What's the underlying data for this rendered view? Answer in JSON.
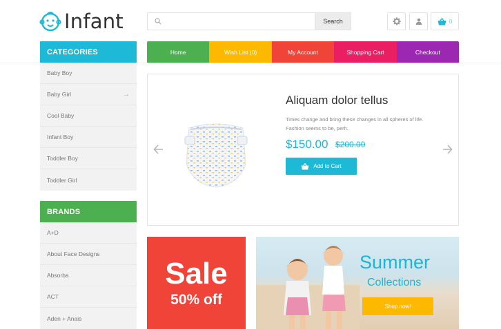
{
  "header": {
    "logo_text": "Infant",
    "search": {
      "placeholder": "",
      "button_label": "Search"
    },
    "cart_count": "0"
  },
  "nav": [
    {
      "label": "Home",
      "color": "#4caf50"
    },
    {
      "label": "Wish List (0)",
      "color": "#fcb900"
    },
    {
      "label": "My Account",
      "color": "#f04438"
    },
    {
      "label": "Shopping Cart",
      "color": "#e91e63"
    },
    {
      "label": "Checkout",
      "color": "#9c27b0"
    }
  ],
  "categories": {
    "title": "CATEGORIES",
    "color": "#1eb9d6",
    "items": [
      "Baby Boy",
      "Baby Girl",
      "Cool Baby",
      "Infant Boy",
      "Toddler Boy",
      "Toddler Girl"
    ]
  },
  "brands": {
    "title": "BRANDS",
    "color": "#4caf50",
    "items": [
      "A+D",
      "About Face Designs",
      "Absorba",
      "ACT",
      "Aden + Anais"
    ]
  },
  "slider": {
    "title": "Aliquam dolor tellus",
    "description": "Times change and bring these changes in all spheres of life. Fashion seems to be, perh..",
    "price": "$150.00",
    "old_price": "$200.00",
    "add_to_cart": "Add to Cart"
  },
  "banners": {
    "sale": {
      "title": "Sale",
      "subtitle": "50% off"
    },
    "summer": {
      "title": "Summer",
      "subtitle": "Collections",
      "button": "Shop now!"
    }
  },
  "icons": {
    "logo": "baby-face-icon",
    "search": "search-icon",
    "settings": "gear-icon",
    "account": "user-icon",
    "cart": "basket-icon",
    "prev": "arrow-left-icon",
    "next": "arrow-right-icon",
    "submenu": "chevron-right-icon"
  },
  "colors": {
    "accent": "#1eb9d6",
    "sale": "#f04438",
    "shop_button": "#fcb900"
  }
}
